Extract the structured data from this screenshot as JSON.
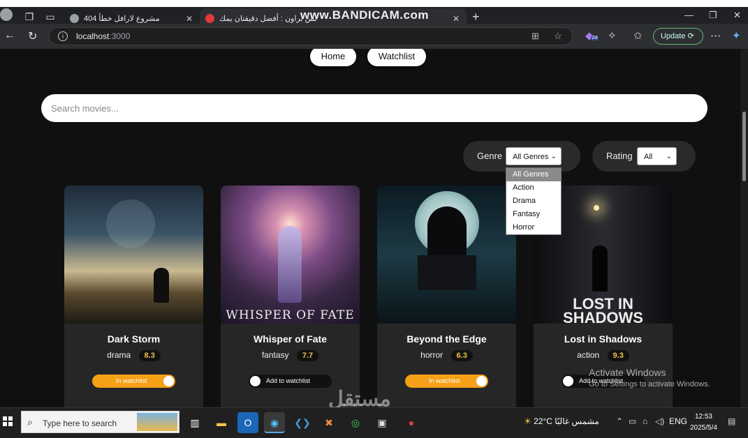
{
  "browser": {
    "tabs": [
      {
        "label": "مشروع لارافل خطأ 404",
        "favicon_color": "#9aa0a6"
      },
      {
        "label": "لس براون : أفضل دقيقتان يمك",
        "favicon_color": "#e03b3b"
      }
    ],
    "recorder_watermark": "www.BANDICAM.com",
    "url_host": "localhost",
    "url_port": ":3000",
    "update_label": "Update",
    "badge_count": "24"
  },
  "nav": {
    "home_label": "Home",
    "watchlist_label": "Watchlist"
  },
  "search": {
    "placeholder": "Search movies..."
  },
  "filters": {
    "genre_label": "Genre",
    "genre_selected": "All Genres",
    "genre_options": [
      "All Genres",
      "Action",
      "Drama",
      "Fantasy",
      "Horror"
    ],
    "rating_label": "Rating",
    "rating_selected": "All"
  },
  "movies": [
    {
      "title": "Dark Storm",
      "genre": "drama",
      "rating": "8.3",
      "poster_text": "",
      "watchlist_label": "In watchlist",
      "in_watchlist": true
    },
    {
      "title": "Whisper of Fate",
      "genre": "fantasy",
      "rating": "7.7",
      "poster_text": "WHISPER OF FATE",
      "watchlist_label": "Add to watchlist",
      "in_watchlist": false
    },
    {
      "title": "Beyond the Edge",
      "genre": "horror",
      "rating": "6.3",
      "poster_text": "",
      "watchlist_label": "In watchlist",
      "in_watchlist": true
    },
    {
      "title": "Lost in Shadows",
      "genre": "action",
      "rating": "9.3",
      "poster_text": "LOST IN SHADOWS",
      "watchlist_label": "Add to watchlist",
      "in_watchlist": false
    }
  ],
  "os_overlay": {
    "activate_title": "Activate Windows",
    "activate_sub": "Go to Settings to activate Windows.",
    "site_watermark": "مستقل"
  },
  "taskbar": {
    "search_placeholder": "Type here to search",
    "weather": "22°C  مشمس غالبًا",
    "language": "ENG",
    "time": "12:53",
    "date": "2025/5/4"
  },
  "colors": {
    "accent_orange": "#f5a017",
    "rating_yellow": "#f4c04a",
    "page_bg": "#101010",
    "card_bg": "#262626"
  }
}
